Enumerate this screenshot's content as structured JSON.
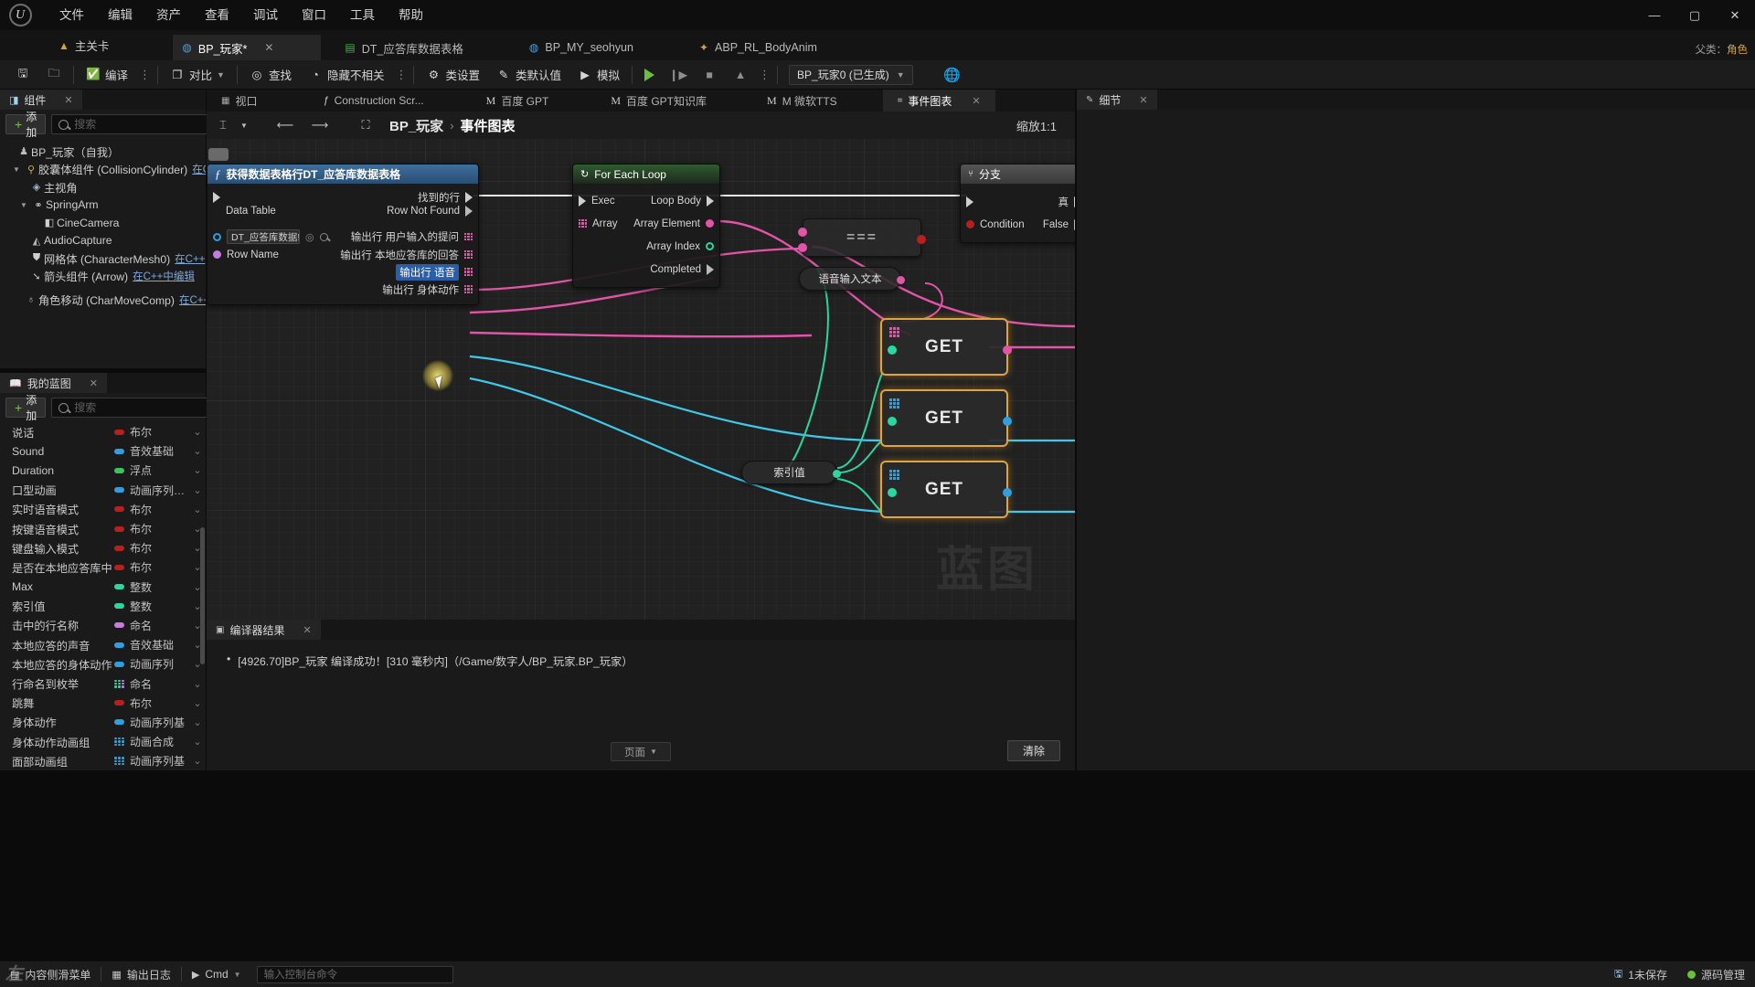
{
  "app": {
    "logo": "ue-logo",
    "menu": [
      "文件",
      "编辑",
      "资产",
      "查看",
      "调试",
      "窗口",
      "工具",
      "帮助"
    ],
    "window_controls": {
      "minimize": "—",
      "maximize": "▢",
      "close": "✕"
    }
  },
  "tabs": {
    "level_tab": {
      "label": "主关卡",
      "icon": "level-icon"
    },
    "assets": [
      {
        "label": "BP_玩家*",
        "icon": "blueprint-icon",
        "active": true,
        "close": "✕"
      },
      {
        "label": "DT_应答库数据表格",
        "icon": "datatable-icon",
        "active": false
      },
      {
        "label": "BP_MY_seohyun",
        "icon": "blueprint-icon",
        "active": false
      },
      {
        "label": "ABP_RL_BodyAnim",
        "icon": "animblueprint-icon",
        "active": false
      }
    ],
    "parent_label": "父类：",
    "parent_value": "角色"
  },
  "toolbar": {
    "save_icon": "save-icon",
    "browse_icon": "browse-content-icon",
    "compile_label": "编译",
    "compile_icon": "compile-check-icon",
    "diff_label": "对比",
    "diff_icon": "diff-icon",
    "find_label": "查找",
    "find_icon": "find-icon",
    "hide_unrelated_label": "隐藏不相关",
    "hide_unrelated_icon": "hide-unrelated-icon",
    "class_settings_label": "类设置",
    "class_settings_icon": "gear-icon",
    "class_defaults_label": "类默认值",
    "class_defaults_icon": "pencil-icon",
    "simulate_label": "模拟",
    "simulate_icon": "play-simulate-icon",
    "play_icon": "play-icon",
    "step_icon": "step-icon",
    "stop_icon": "stop-icon",
    "eject_icon": "eject-icon",
    "overflow_icon": "kebab-icon",
    "debug_object": "BP_玩家0 (已生成)",
    "debug_chevron": "chevron-down-icon",
    "platform_icon": "globe-icon"
  },
  "components_panel": {
    "title": "组件",
    "close": "✕",
    "icon": "components-icon",
    "add_label": "添加",
    "search_placeholder": "搜索",
    "tree": [
      {
        "label": "BP_玩家（自我）",
        "icon": "actor-icon",
        "indent": 0,
        "caret": "",
        "cpp": ""
      },
      {
        "label": "胶囊体组件 (CollisionCylinder)",
        "icon": "capsule-icon",
        "indent": 1,
        "caret": "▼",
        "cpp": "在C+"
      },
      {
        "label": "主视角",
        "icon": "camera-box-icon",
        "indent": 2,
        "caret": "",
        "cpp": ""
      },
      {
        "label": "SpringArm",
        "icon": "springarm-icon",
        "indent": 2,
        "caret": "▼",
        "cpp": ""
      },
      {
        "label": "CineCamera",
        "icon": "cinecamera-icon",
        "indent": 3,
        "caret": "",
        "cpp": ""
      },
      {
        "label": "AudioCapture",
        "icon": "audio-icon",
        "indent": 2,
        "caret": "",
        "cpp": ""
      },
      {
        "label": "网格体 (CharacterMesh0)",
        "icon": "mesh-icon",
        "indent": 2,
        "caret": "",
        "cpp": "在C++"
      },
      {
        "label": "箭头组件 (Arrow)",
        "icon": "arrow-comp-icon",
        "indent": 2,
        "caret": "",
        "cpp": "在C++中编辑"
      },
      {
        "label": "角色移动 (CharMoveComp)",
        "icon": "charmove-icon",
        "indent": 1,
        "caret": "",
        "cpp": "在C++中"
      }
    ]
  },
  "myblueprint_panel": {
    "title": "我的蓝图",
    "close": "✕",
    "icon": "book-icon",
    "add_label": "添加",
    "search_placeholder": "搜索",
    "settings_icon": "gear-icon",
    "variables": [
      {
        "name": "说话",
        "type": "布尔",
        "pin": "bool",
        "color": "#b81f1f"
      },
      {
        "name": "Sound",
        "type": "音效基础",
        "pin": "obj",
        "color": "#2f9fe0"
      },
      {
        "name": "Duration",
        "type": "浮点",
        "pin": "float",
        "color": "#38c45e"
      },
      {
        "name": "口型动画",
        "type": "动画序列基础",
        "pin": "obj",
        "color": "#2f9fe0"
      },
      {
        "name": "实时语音模式",
        "type": "布尔",
        "pin": "bool",
        "color": "#b81f1f"
      },
      {
        "name": "按键语音模式",
        "type": "布尔",
        "pin": "bool",
        "color": "#b81f1f"
      },
      {
        "name": "键盘输入模式",
        "type": "布尔",
        "pin": "bool",
        "color": "#b81f1f"
      },
      {
        "name": "是否在本地应答库中",
        "type": "布尔",
        "pin": "bool",
        "color": "#b81f1f"
      },
      {
        "name": "Max",
        "type": "整数",
        "pin": "int",
        "color": "#2cd6a0"
      },
      {
        "name": "索引值",
        "type": "整数",
        "pin": "int",
        "color": "#2cd6a0"
      },
      {
        "name": "击中的行名称",
        "type": "命名",
        "pin": "name",
        "color": "#c77ae0"
      },
      {
        "name": "本地应答的声音",
        "type": "音效基础",
        "pin": "obj",
        "color": "#2f9fe0"
      },
      {
        "name": "本地应答的身体动作",
        "type": "动画序列",
        "pin": "obj",
        "color": "#2f9fe0"
      },
      {
        "name": "行命名到枚举",
        "type": "命名",
        "pin": "map",
        "color": "#2cd6a0"
      },
      {
        "name": "跳舞",
        "type": "布尔",
        "pin": "bool",
        "color": "#b81f1f"
      },
      {
        "name": "身体动作",
        "type": "动画序列基",
        "pin": "obj",
        "color": "#2f9fe0"
      },
      {
        "name": "身体动作动画组",
        "type": "动画合成",
        "pin": "array",
        "color": "#2f9fe0"
      },
      {
        "name": "面部动画组",
        "type": "动画序列基",
        "pin": "array",
        "color": "#2f9fe0"
      }
    ]
  },
  "graph": {
    "tabs": [
      {
        "label": "视口",
        "icon": "viewport-icon",
        "active": false
      },
      {
        "label": "Construction Scr...",
        "icon": "function-icon",
        "active": false
      },
      {
        "label": "百度 GPT",
        "icon": "macro-icon",
        "active": false
      },
      {
        "label": "百度 GPT知识库",
        "icon": "macro-icon",
        "active": false
      },
      {
        "label": "M 微软TTS",
        "icon": "macro-icon",
        "active": false
      },
      {
        "label": "事件图表",
        "icon": "eventgraph-icon",
        "active": true,
        "close": "✕"
      }
    ],
    "breadcrumb_main": "BP_玩家",
    "breadcrumb_sep": "›",
    "breadcrumb_sub": "事件图表",
    "zoom_label": "缩放1:1",
    "watermark": "蓝图",
    "toolbar_icons": [
      "cursor-mode-icon",
      "chevron-down-icon",
      "nav-back-icon",
      "nav-forward-icon",
      "grid-icon"
    ],
    "nodes": {
      "get_datatable_row": {
        "title": "获得数据表格行DT_应答库数据表格",
        "icon": "function-f-icon",
        "comment_icon": "comment-bubble-icon",
        "inputs": [
          {
            "label": "Data Table",
            "pin": "obj",
            "color": "#2f9fe0",
            "value": "DT_应答库数据!"
          },
          {
            "label": "Row Name",
            "pin": "name",
            "color": "#c77ae0"
          }
        ],
        "outputs": [
          {
            "label": "找到的行",
            "pin": "exec"
          },
          {
            "label": "Row Not Found",
            "pin": "exec"
          },
          {
            "label": "输出行 用户输入的提问",
            "pin": "struct",
            "color": "#2f9fe0"
          },
          {
            "label": "输出行 本地应答库的回答",
            "pin": "struct",
            "color": "#2f9fe0"
          },
          {
            "label": "输出行 语音",
            "pin": "struct",
            "color": "#2f9fe0",
            "selected": true
          },
          {
            "label": "输出行 身体动作",
            "pin": "struct",
            "color": "#2f9fe0"
          }
        ]
      },
      "for_each_loop": {
        "title": "For Each Loop",
        "icon": "loop-icon",
        "inputs": [
          {
            "label": "Exec",
            "pin": "exec"
          },
          {
            "label": "Array",
            "pin": "array",
            "color": "#c77ae0"
          }
        ],
        "outputs": [
          {
            "label": "Loop Body",
            "pin": "exec"
          },
          {
            "label": "Array Element",
            "pin": "dot",
            "color": "#e254a8"
          },
          {
            "label": "Array Index",
            "pin": "dot",
            "color": "#2cd6a0"
          },
          {
            "label": "Completed",
            "pin": "exec"
          }
        ]
      },
      "branch": {
        "title": "分支",
        "icon": "branch-icon",
        "inputs": [
          {
            "label": "",
            "pin": "exec"
          },
          {
            "label": "Condition",
            "pin": "dot",
            "color": "#b81f1f"
          }
        ],
        "outputs": [
          {
            "label": "真",
            "pin": "exec"
          },
          {
            "label": "False",
            "pin": "exec"
          }
        ]
      },
      "equals_node": {
        "label": "==="
      },
      "voice_text_node": {
        "label": "语音输入文本"
      },
      "index_value_node": {
        "label": "索引值"
      },
      "get_nodes": [
        {
          "label": "GET",
          "color": "#e254a8"
        },
        {
          "label": "GET",
          "color": "#2f9fe0"
        },
        {
          "label": "GET",
          "color": "#2f9fe0"
        }
      ]
    }
  },
  "compiler_panel": {
    "title": "编译器结果",
    "close": "✕",
    "icon": "compiler-icon",
    "messages": [
      "[4926.70]BP_玩家 编译成功！[310 毫秒内]（/Game/数字人/BP_玩家.BP_玩家）"
    ],
    "page_label": "页面",
    "page_chevron": "chevron-down-icon",
    "clear_label": "清除"
  },
  "details_panel": {
    "title": "细节",
    "close": "✕",
    "icon": "details-icon"
  },
  "statusbar": {
    "content_drawer_label": "内容侧滑菜单",
    "content_drawer_icon": "drawer-icon",
    "output_log_label": "输出日志",
    "output_log_icon": "log-icon",
    "cmd_label": "Cmd",
    "cmd_chevron": "chevron-down-icon",
    "cmd_placeholder": "输入控制台命令",
    "saved_label": "1未保存",
    "saved_icon": "save-status-icon",
    "source_control_label": "源码管理",
    "source_control_icon": "source-control-icon",
    "watermark": "左"
  }
}
